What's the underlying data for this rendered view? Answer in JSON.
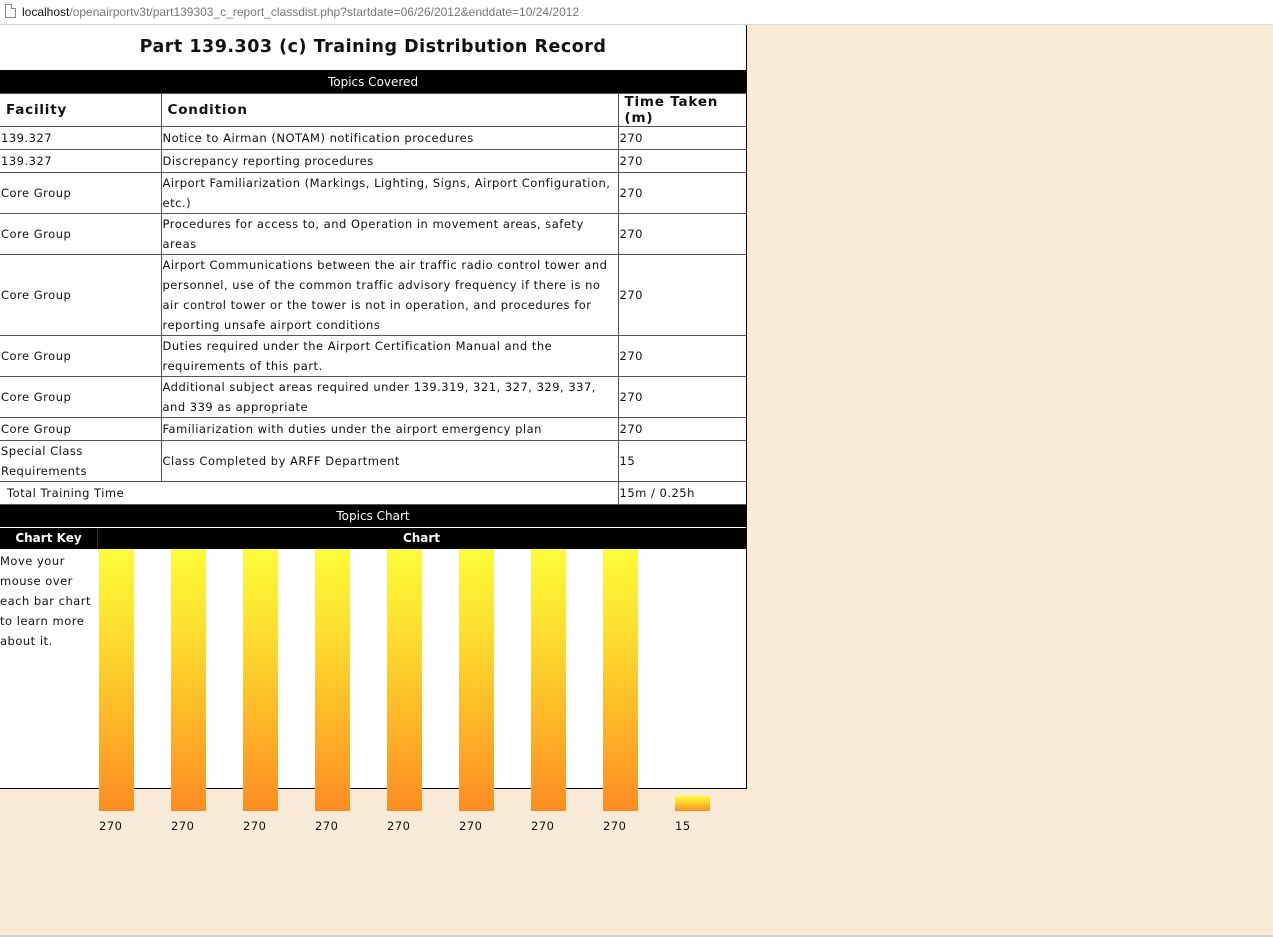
{
  "browser": {
    "url_host": "localhost",
    "url_path": "/openairportv3t/part139303_c_report_classdist.php?startdate=06/26/2012&enddate=10/24/2012",
    "icon": "page-icon"
  },
  "report": {
    "title": "Part 139.303 (c) Training Distribution Record",
    "topics_band": "Topics Covered",
    "columns": [
      "Facility",
      "Condition",
      "Time Taken (m)"
    ],
    "rows": [
      {
        "facility": "139.327",
        "condition": "Notice to Airman (NOTAM) notification procedures",
        "time": "270"
      },
      {
        "facility": "139.327",
        "condition": "Discrepancy reporting procedures",
        "time": "270"
      },
      {
        "facility": "Core Group",
        "condition": "Airport Familiarization (Markings, Lighting, Signs, Airport Configuration, etc.)",
        "time": "270"
      },
      {
        "facility": "Core Group",
        "condition": "Procedures for access to, and Operation in movement areas, safety areas",
        "time": "270"
      },
      {
        "facility": "Core Group",
        "condition": "Airport Communications between the air traffic radio control tower and personnel, use of the common traffic advisory frequency if there is no air control tower or the tower is not in operation, and procedures for reporting unsafe airport conditions",
        "time": "270"
      },
      {
        "facility": "Core Group",
        "condition": "Duties required under the Airport Certification Manual and the requirements of this part.",
        "time": "270"
      },
      {
        "facility": "Core Group",
        "condition": "Additional subject areas required under 139.319, 321, 327, 329, 337, and 339 as appropriate",
        "time": "270"
      },
      {
        "facility": "Core Group",
        "condition": "Familiarization with duties under the airport emergency plan",
        "time": "270"
      },
      {
        "facility": "Special Class Requirements",
        "condition": "Class Completed by ARFF Department",
        "time": "15"
      }
    ],
    "total_label": "Total Training Time",
    "total_value": "15m / 0.25h",
    "chart_band": "Topics Chart",
    "chart_key_header": "Chart Key",
    "chart_header": "Chart",
    "chart_key_text": "Move your mouse over each bar chart to learn more about it."
  },
  "chart_data": {
    "type": "bar",
    "categories": [
      "",
      "",
      "",
      "",
      "",
      "",
      "",
      "",
      ""
    ],
    "values": [
      270,
      270,
      270,
      270,
      270,
      270,
      270,
      270,
      15
    ],
    "data_labels": [
      "270",
      "270",
      "270",
      "270",
      "270",
      "270",
      "270",
      "270",
      "15"
    ],
    "title": "",
    "xlabel": "",
    "ylabel": "",
    "ylim": [
      0,
      270
    ],
    "grid": false,
    "legend": "none",
    "colors": {
      "gradient_top": "#fdfd38",
      "gradient_bottom": "#ff8c22"
    }
  },
  "theme": {
    "page_background": "#f8ead7",
    "band_color": "#000000"
  }
}
